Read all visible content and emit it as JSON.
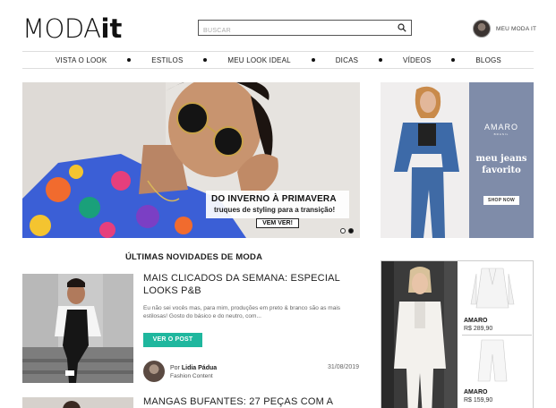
{
  "header": {
    "logo_main": "MODA",
    "logo_it": "it",
    "search_placeholder": "BUSCAR",
    "account_label": "MEU MODA IT"
  },
  "nav": {
    "items": [
      "VISTA O LOOK",
      "ESTILOS",
      "MEU LOOK IDEAL",
      "DICAS",
      "VÍDEOS",
      "BLOGS"
    ]
  },
  "hero": {
    "title": "DO INVERNO À PRIMAVERA",
    "subtitle": "truques de styling para a transição!",
    "button": "VEM VER!"
  },
  "amaro_banner": {
    "brand": "AMARO",
    "brand_sub": "BRASIL",
    "line1": "meu jeans",
    "line2": "favorito",
    "cta": "SHOP NOW"
  },
  "section": {
    "title": "ÚLTIMAS NOVIDADES DE MODA"
  },
  "post1": {
    "title": "MAIS CLICADOS DA SEMANA: ESPECIAL LOOKS P&B",
    "excerpt": "Eu não sei vocês mas, para mim, produções em preto & branco são as mais estilosas! Gosto do básico e do neutro, com...",
    "button": "VER O POST",
    "author_prefix": "Por",
    "author_name": "Lidia Pádua",
    "category": "Fashion Content",
    "date": "31/08/2019"
  },
  "post2": {
    "title": "MANGAS BUFANTES: 27 PEÇAS COM A"
  },
  "ad": {
    "products": [
      {
        "brand": "AMARO",
        "price": "R$ 289,90"
      },
      {
        "brand": "AMARO",
        "price": "R$ 159,90"
      }
    ]
  },
  "colors": {
    "accent_button": "#1fb79e",
    "amaro_panel": "#7f8ca9"
  }
}
